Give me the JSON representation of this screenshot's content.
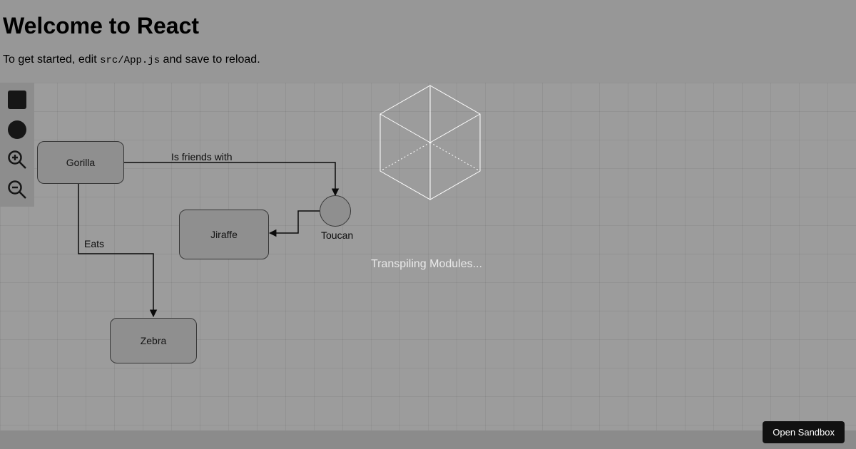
{
  "header": {
    "title": "Welcome to React",
    "intro_prefix": "To get started, edit ",
    "intro_code": "src/App.js",
    "intro_suffix": " and save to reload."
  },
  "toolbar": {
    "items": [
      {
        "name": "square-shape-tool"
      },
      {
        "name": "circle-shape-tool"
      },
      {
        "name": "zoom-in-tool"
      },
      {
        "name": "zoom-out-tool"
      }
    ]
  },
  "nodes": {
    "gorilla": {
      "label": "Gorilla"
    },
    "jiraffe": {
      "label": "Jiraffe"
    },
    "zebra": {
      "label": "Zebra"
    },
    "toucan": {
      "label": "Toucan"
    }
  },
  "edges": {
    "gorilla_toucan": {
      "label": "Is friends with"
    },
    "gorilla_zebra": {
      "label": "Eats"
    },
    "toucan_jiraffe": {
      "label": ""
    }
  },
  "overlay": {
    "status_text": "Transpiling Modules..."
  },
  "actions": {
    "open_sandbox": "Open Sandbox"
  }
}
